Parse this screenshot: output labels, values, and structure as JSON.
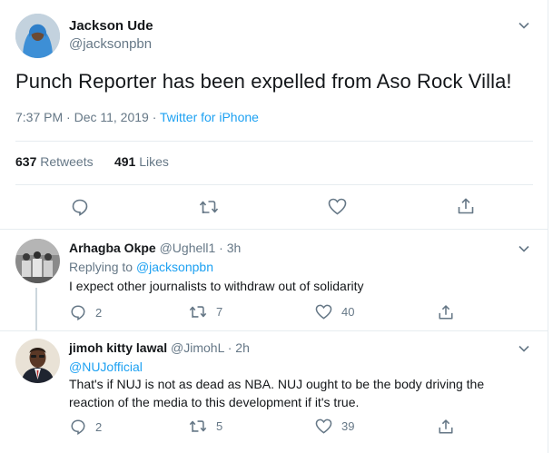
{
  "main_tweet": {
    "author_name": "Jackson Ude",
    "author_handle": "@jacksonpbn",
    "text": "Punch Reporter has been expelled from Aso Rock Villa!",
    "timestamp": "7:37 PM · Dec 11, 2019 · ",
    "source": "Twitter for iPhone",
    "retweets_count": "637",
    "retweets_label": "Retweets",
    "likes_count": "491",
    "likes_label": "Likes"
  },
  "replies": [
    {
      "author_name": "Arhagba Okpe",
      "author_handle": "@Ughell1",
      "time": "· 3h",
      "replying_prefix": "Replying to ",
      "replying_to": "@jacksonpbn",
      "text": "I expect other journalists to withdraw out of solidarity",
      "reply_count": "2",
      "retweet_count": "7",
      "like_count": "40"
    },
    {
      "author_name": "jimoh kitty lawal",
      "author_handle": "@JimohL",
      "time": "· 2h",
      "mention": "@NUJofficial",
      "text": "That's if NUJ is not as dead as NBA. NUJ ought to be the body driving the reaction of the media to this development if it's true.",
      "reply_count": "2",
      "retweet_count": "5",
      "like_count": "39"
    }
  ],
  "colors": {
    "accent": "#1da1f2",
    "secondary_text": "#657786",
    "primary_text": "#14171a",
    "border": "#e6ecf0"
  },
  "icons": [
    "reply-icon",
    "retweet-icon",
    "like-icon",
    "share-icon",
    "chevron-down-icon"
  ]
}
